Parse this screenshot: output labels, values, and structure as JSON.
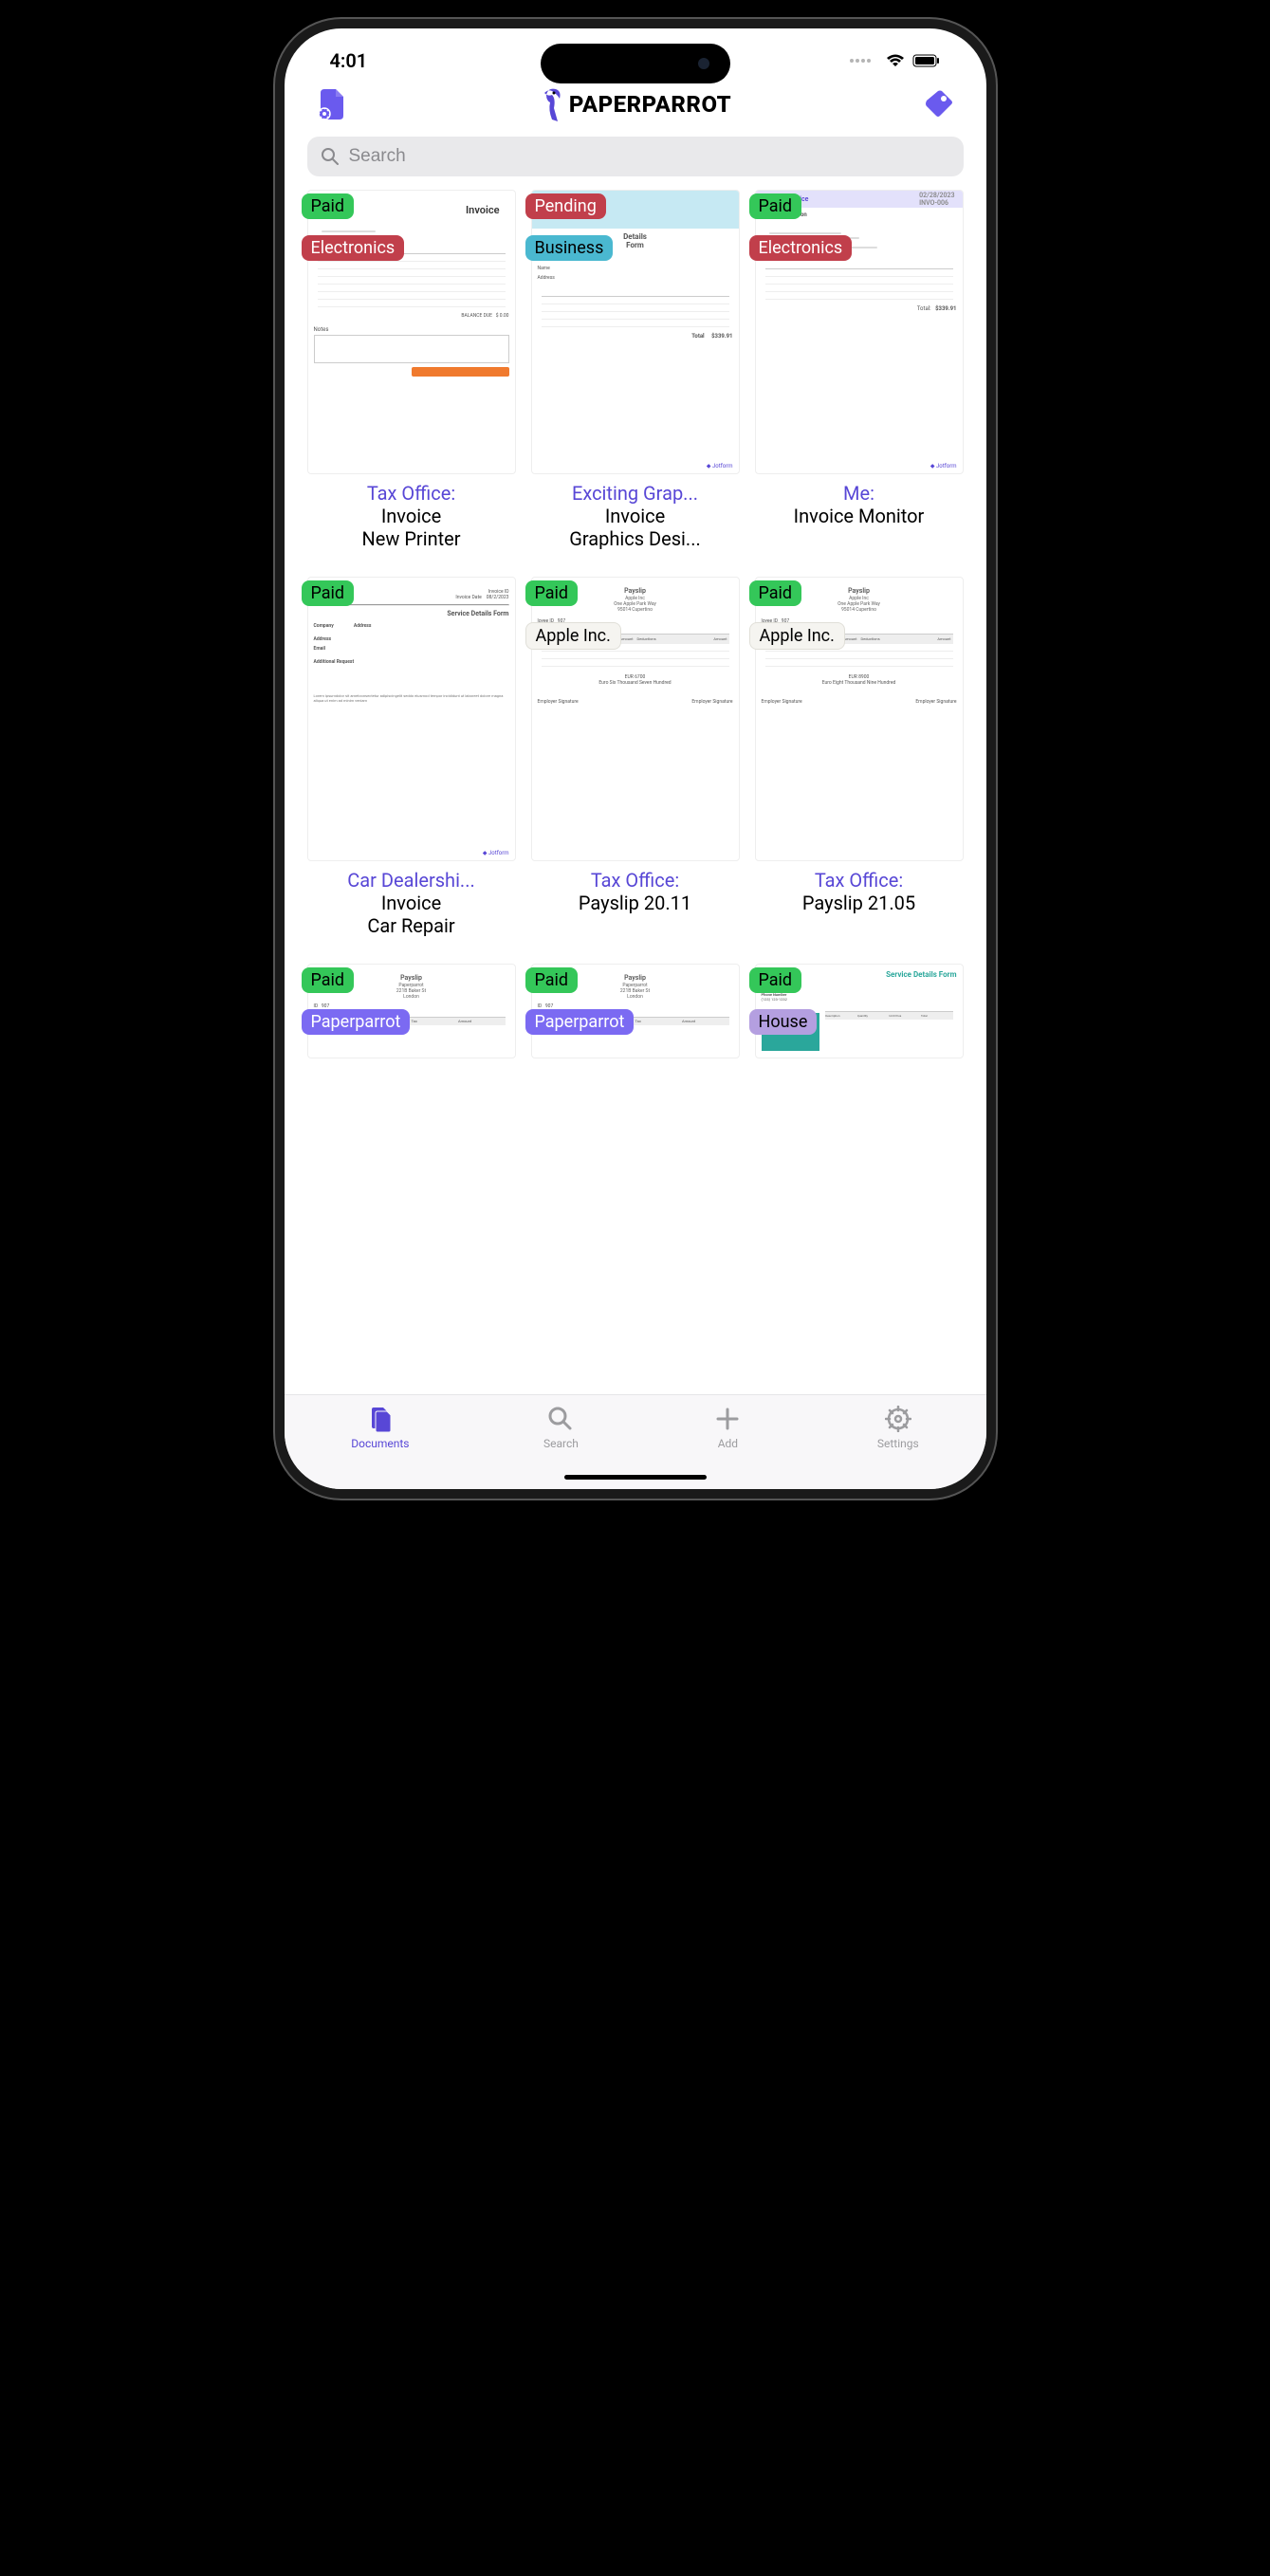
{
  "statusBar": {
    "time": "4:01"
  },
  "header": {
    "appName": "PAPERPARROT",
    "leftIcon": "settings-document-icon",
    "rightIcon": "tag-icon"
  },
  "search": {
    "placeholder": "Search"
  },
  "colors": {
    "accent": "#5847d6",
    "paid": "#34c759",
    "pending": "#c13f4b"
  },
  "badges": {
    "paid": "Paid",
    "pending": "Pending",
    "electronics": "Electronics",
    "business": "Business",
    "apple": "Apple Inc.",
    "paperparrot": "Paperparrot",
    "house": "House"
  },
  "documents": [
    {
      "status": "Paid",
      "statusColor": "green",
      "tag": "Electronics",
      "tagColor": "redtag",
      "correspondent": "Tax Office:",
      "type": "Invoice",
      "title": "New Printer",
      "thumbStyle": "invoice1"
    },
    {
      "status": "Pending",
      "statusColor": "red",
      "tag": "Business",
      "tagColor": "blue",
      "correspondent": "Exciting Grap...",
      "type": "Invoice",
      "title": "Graphics Desi...",
      "thumbStyle": "invoice2"
    },
    {
      "status": "Paid",
      "statusColor": "green",
      "tag": "Electronics",
      "tagColor": "redtag",
      "correspondent": "Me:",
      "type": "Invoice Monitor",
      "title": "",
      "thumbStyle": "invoice3"
    },
    {
      "status": "Paid",
      "statusColor": "green",
      "tag": "",
      "tagColor": "",
      "correspondent": "Car Dealershi...",
      "type": "Invoice",
      "title": "Car Repair",
      "thumbStyle": "service"
    },
    {
      "status": "Paid",
      "statusColor": "green",
      "tag": "Apple Inc.",
      "tagColor": "white",
      "correspondent": "Tax Office:",
      "type": "Payslip 20.11",
      "title": "",
      "thumbStyle": "payslip1"
    },
    {
      "status": "Paid",
      "statusColor": "green",
      "tag": "Apple Inc.",
      "tagColor": "white",
      "correspondent": "Tax Office:",
      "type": "Payslip 21.05",
      "title": "",
      "thumbStyle": "payslip2"
    },
    {
      "status": "Paid",
      "statusColor": "green",
      "tag": "Paperparrot",
      "tagColor": "purple",
      "correspondent": "",
      "type": "",
      "title": "",
      "thumbStyle": "payslip3"
    },
    {
      "status": "Paid",
      "statusColor": "green",
      "tag": "Paperparrot",
      "tagColor": "purple",
      "correspondent": "",
      "type": "",
      "title": "",
      "thumbStyle": "payslip3"
    },
    {
      "status": "Paid",
      "statusColor": "green",
      "tag": "House",
      "tagColor": "lav",
      "correspondent": "",
      "type": "",
      "title": "",
      "thumbStyle": "service2"
    }
  ],
  "tabs": [
    {
      "label": "Documents",
      "icon": "documents-icon",
      "active": true
    },
    {
      "label": "Search",
      "icon": "search-icon",
      "active": false
    },
    {
      "label": "Add",
      "icon": "plus-icon",
      "active": false
    },
    {
      "label": "Settings",
      "icon": "gear-icon",
      "active": false
    }
  ]
}
